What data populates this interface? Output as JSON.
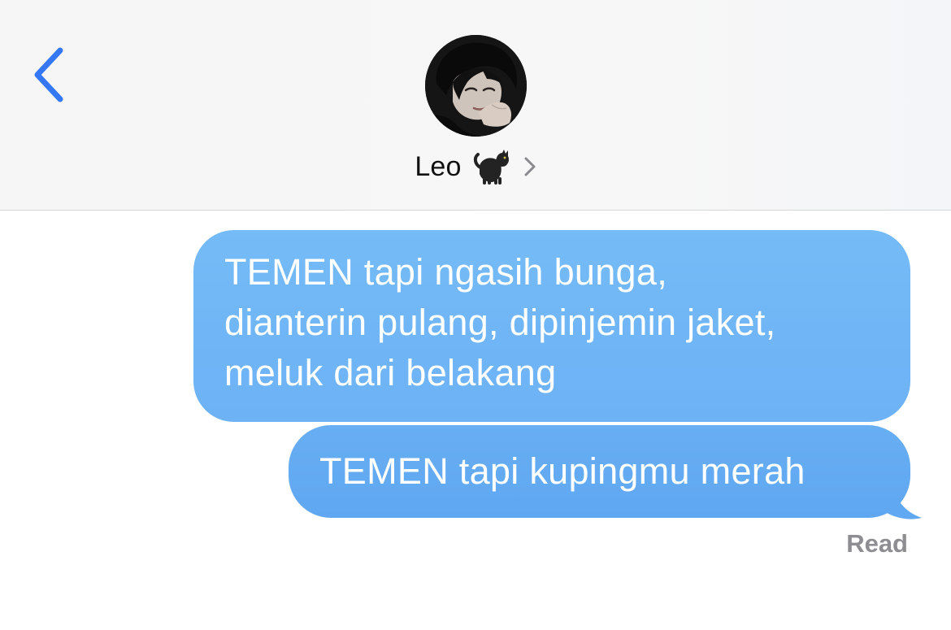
{
  "colors": {
    "accent": "#3478f6",
    "bubble": "#6bb1f5",
    "header_bg": "#f7f7f7",
    "secondary_text": "#8d8d92"
  },
  "header": {
    "back_icon": "chevron-left-icon",
    "contact": {
      "name": "Leo",
      "emoji": "🐈‍⬛",
      "detail_icon": "chevron-right-icon"
    }
  },
  "messages": [
    {
      "direction": "outgoing",
      "lines": [
        "TEMEN tapi ngasih bunga,",
        "dianterin pulang, dipinjemin jaket,",
        "meluk dari belakang"
      ]
    },
    {
      "direction": "outgoing",
      "text": "TEMEN tapi kupingmu merah"
    }
  ],
  "status": {
    "read_label": "Read"
  }
}
